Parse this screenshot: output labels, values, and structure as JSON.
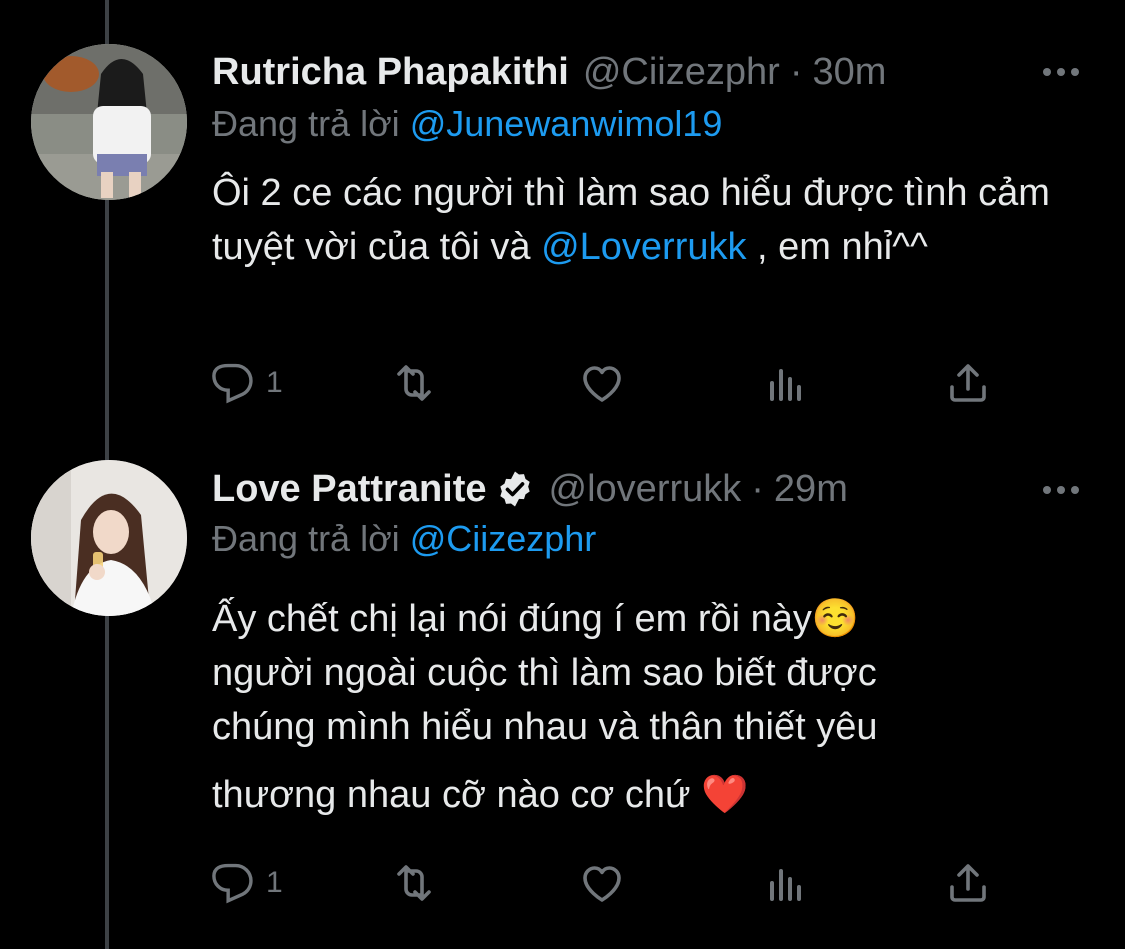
{
  "tweets": [
    {
      "name": "Rutricha Phapakithi",
      "handle": "@Ciizezphr",
      "separator": "·",
      "time": "30m",
      "replying_prefix": "Đang trả lời",
      "replying_to": "@Junewanwimol19",
      "text_part1": "Ôi 2 ce các người thì làm sao hiểu được tình cảm tuyệt vời của tôi và ",
      "text_mention": "@Loverrukk",
      "text_part2": " , em nhỉ^^",
      "reply_count": "1",
      "verified": false,
      "more_icon": "more-icon"
    },
    {
      "name": "Love Pattranite",
      "handle": "@loverrukk",
      "separator": "·",
      "time": "29m",
      "replying_prefix": "Đang trả lời",
      "replying_to": "@Ciizezphr",
      "lines": [
        "Ấy chết chị lại nói đúng í em rồi này☺️",
        "người ngoài cuộc thì làm sao biết được",
        "chúng mình hiểu nhau và thân thiết yêu",
        "thương nhau cỡ nào cơ chứ ❤️"
      ],
      "reply_count": "1",
      "verified": true,
      "more_icon": "more-icon"
    }
  ],
  "colors": {
    "background": "#000000",
    "text": "#e7e9ea",
    "muted": "#71767b",
    "link": "#1d9bf0",
    "thread_line": "#3d4145"
  },
  "icons": [
    "reply-icon",
    "retweet-icon",
    "like-icon",
    "analytics-icon",
    "share-icon",
    "verified-icon",
    "more-icon",
    "avatar"
  ]
}
